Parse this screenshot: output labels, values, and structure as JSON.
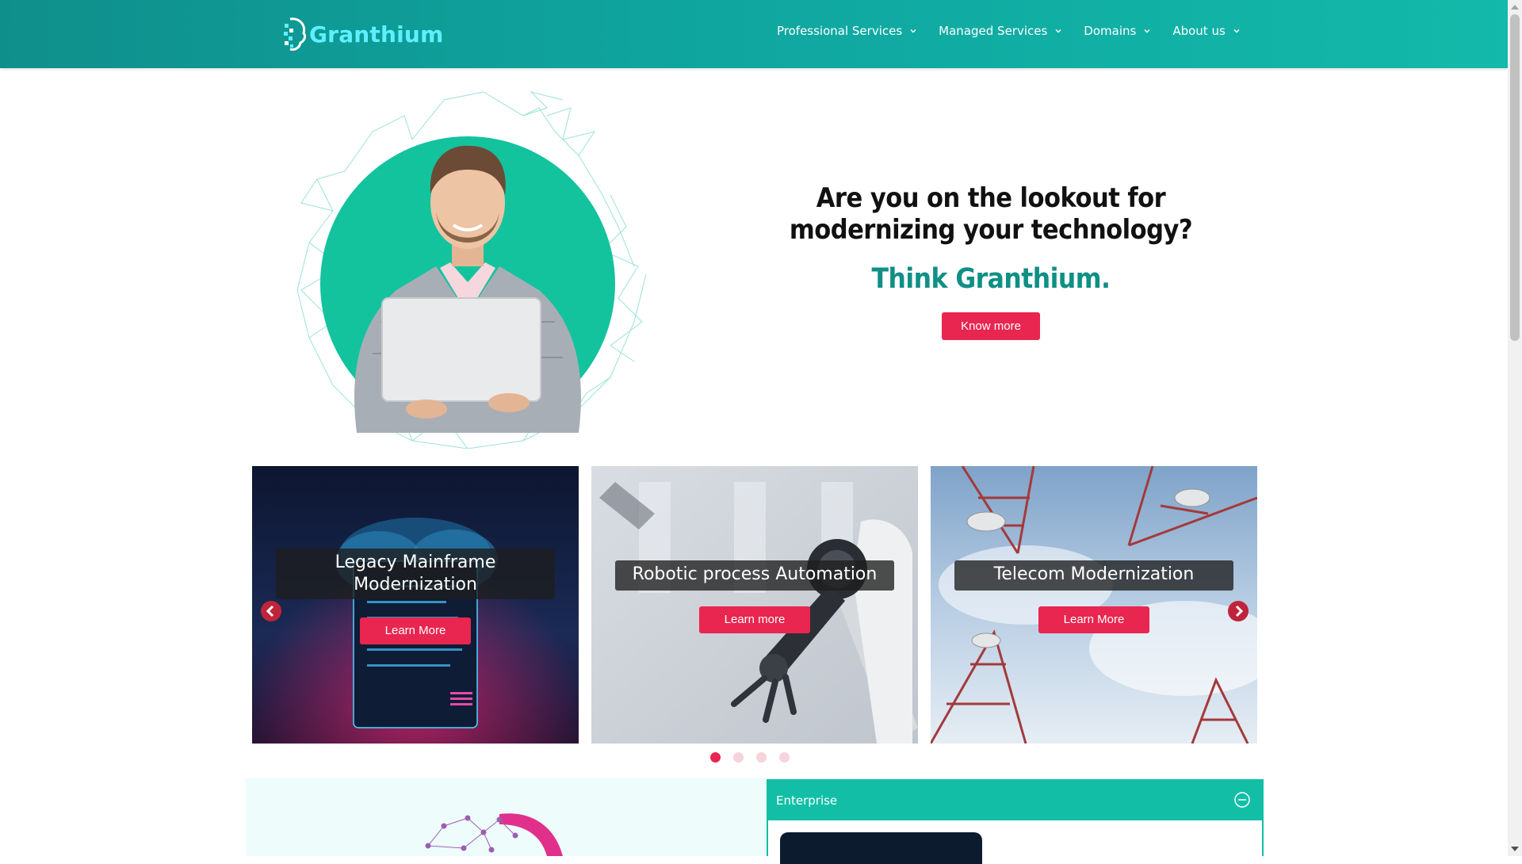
{
  "header": {
    "logo_text": "Granthium",
    "nav": [
      {
        "label": "Professional Services"
      },
      {
        "label": "Managed Services"
      },
      {
        "label": "Domains"
      },
      {
        "label": "About us"
      }
    ]
  },
  "hero": {
    "title": "Are you on the lookout for modernizing your technology?",
    "tagline": "Think Granthium.",
    "cta_label": "Know more"
  },
  "carousel": {
    "cards": [
      {
        "title": "Legacy Mainframe Modernization",
        "button": "Learn More",
        "image": "cloud-server-image"
      },
      {
        "title": "Robotic process Automation",
        "button": "Learn more",
        "image": "robotic-arm-image"
      },
      {
        "title": "Telecom Modernization",
        "button": "Learn More",
        "image": "telecom-towers-image"
      }
    ],
    "dots": 4,
    "active_dot": 1
  },
  "accordion": {
    "title": "Enterprise",
    "expanded": true
  },
  "colors": {
    "header": "#0fa59f",
    "logo": "#5ef0ff",
    "accent": "#e8264f",
    "tagline": "#0f8f85",
    "accordion": "#12bfa6"
  }
}
